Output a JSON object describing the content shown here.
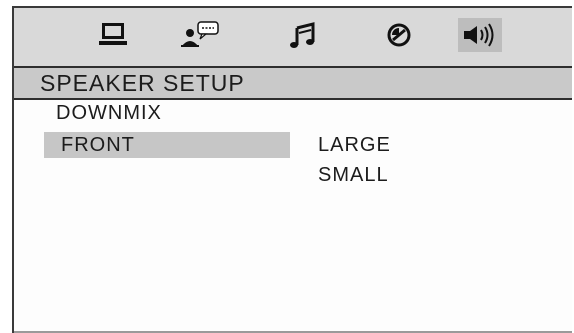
{
  "toolbar": {
    "icons": [
      {
        "name": "system-setup",
        "icon": "monitor-icon"
      },
      {
        "name": "language-setup",
        "icon": "person-speech-icon"
      },
      {
        "name": "audio-setup",
        "icon": "music-note-icon"
      },
      {
        "name": "video-setup",
        "icon": "dial-icon"
      },
      {
        "name": "speaker-setup",
        "icon": "speaker-icon",
        "active": true
      }
    ]
  },
  "page": {
    "title": "SPEAKER SETUP"
  },
  "menu": {
    "items": [
      {
        "label": "DOWNMIX"
      },
      {
        "label": "FRONT",
        "selected": true
      }
    ]
  },
  "options": {
    "items": [
      {
        "label": "LARGE"
      },
      {
        "label": "SMALL"
      }
    ]
  }
}
